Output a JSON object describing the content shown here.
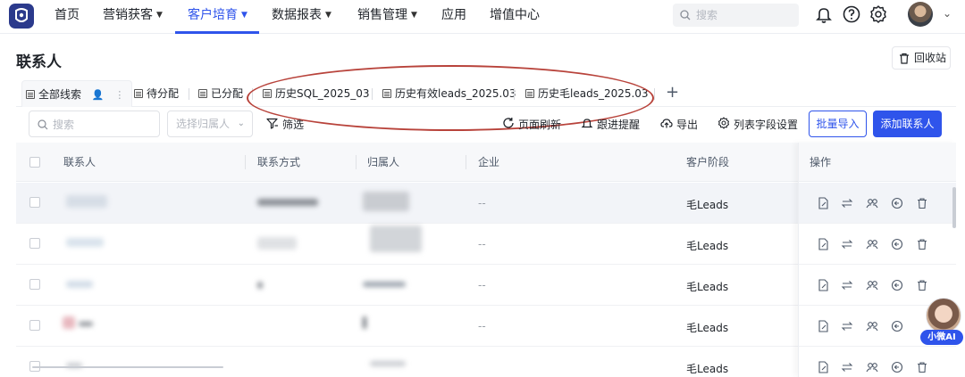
{
  "nav": {
    "items": [
      "首页",
      "营销获客",
      "客户培育",
      "数据报表",
      "销售管理",
      "应用",
      "增值中心"
    ],
    "active": "客户培育",
    "search_placeholder": "搜索"
  },
  "page": {
    "title": "联系人",
    "recycle_label": "回收站"
  },
  "tabs": {
    "items": [
      "全部线索",
      "待分配",
      "已分配",
      "历史SQL_2025_03",
      "历史有效leads_2025.03",
      "历史毛leads_2025.03"
    ],
    "add": "+"
  },
  "toolbar": {
    "search_placeholder": "搜索",
    "owner_placeholder": "选择归属人",
    "filter_label": "筛选",
    "refresh_label": "页面刷新",
    "reminder_label": "跟进提醒",
    "export_label": "导出",
    "columns_label": "列表字段设置",
    "import_label": "批量导入",
    "add_label": "添加联系人"
  },
  "table": {
    "columns": [
      "联系人",
      "联系方式",
      "归属人",
      "企业",
      "客户阶段",
      "操作"
    ],
    "rows": [
      {
        "company": "--",
        "stage": "毛Leads"
      },
      {
        "company": "--",
        "stage": "毛Leads"
      },
      {
        "company": "--",
        "stage": "毛Leads"
      },
      {
        "company": "--",
        "stage": "毛Leads"
      },
      {
        "company": "",
        "stage": "毛Leads"
      }
    ]
  },
  "ai_widget": {
    "label": "小微AI"
  },
  "colors": {
    "primary": "#2f54eb",
    "annotation_oval": "#b8433b",
    "logo": "#2b3a8c"
  }
}
